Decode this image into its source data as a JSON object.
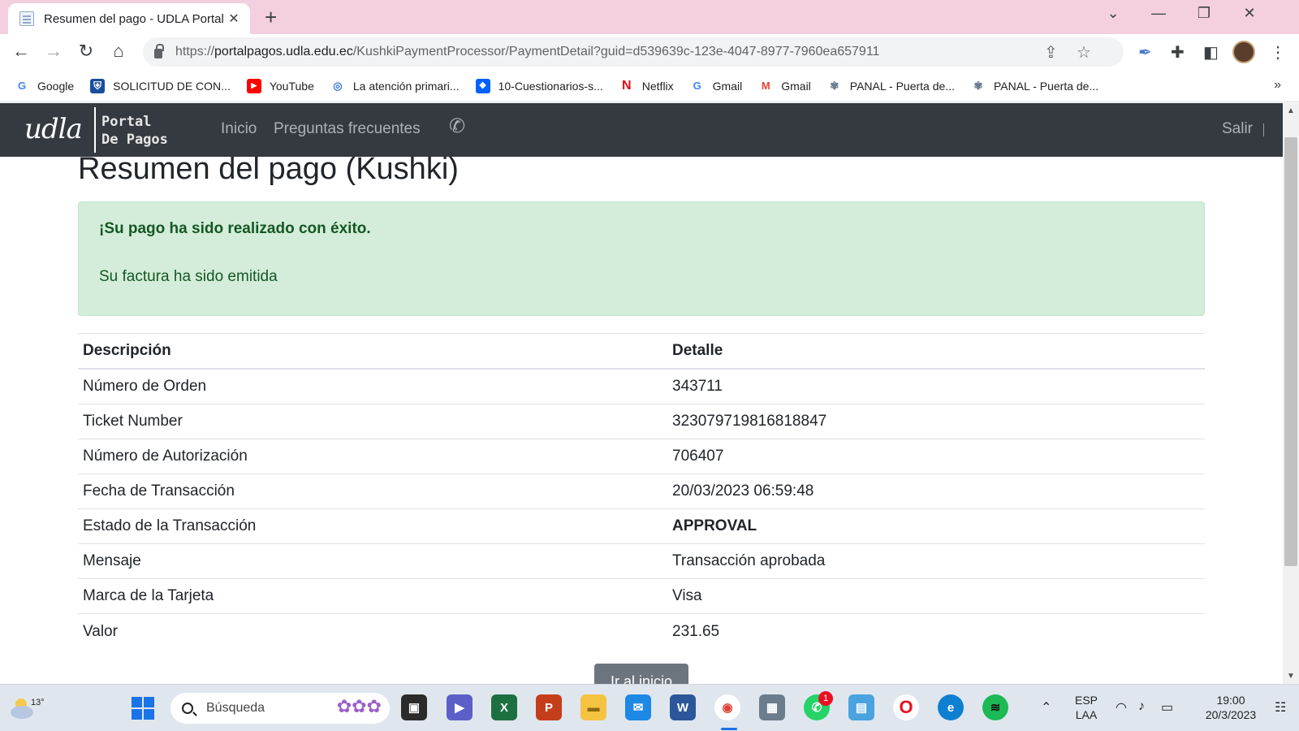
{
  "browser": {
    "tab_title": "Resumen del pago - UDLA Portal",
    "url_scheme": "https://",
    "url_host": "portalpagos.udla.edu.ec",
    "url_path": "/KushkiPaymentProcessor/PaymentDetail?guid=d539639c-123e-4047-8977-7960ea657911",
    "bookmarks": [
      {
        "label": "Google",
        "icon": "google-icon",
        "color": "#4285f4"
      },
      {
        "label": "SOLICITUD DE CON...",
        "icon": "shield-icon",
        "color": "#1b4f9c"
      },
      {
        "label": "YouTube",
        "icon": "youtube-icon",
        "color": "#ff0000"
      },
      {
        "label": "La atención primari...",
        "icon": "un-icon",
        "color": "#3a7bd5"
      },
      {
        "label": "10-Cuestionarios-s...",
        "icon": "dropbox-icon",
        "color": "#0061ff"
      },
      {
        "label": "Netflix",
        "icon": "netflix-icon",
        "color": "#e50914"
      },
      {
        "label": "Gmail",
        "icon": "google-icon",
        "color": "#4285f4"
      },
      {
        "label": "Gmail",
        "icon": "gmail-icon",
        "color": "#ea4335"
      },
      {
        "label": "PANAL - Puerta de...",
        "icon": "bees-icon",
        "color": "#6b7a8f"
      },
      {
        "label": "PANAL - Puerta de...",
        "icon": "bees-icon",
        "color": "#6b7a8f"
      }
    ]
  },
  "navbar": {
    "logo_script": "udla",
    "logo_text": "Portal De Pagos",
    "links": [
      "Inicio",
      "Preguntas frecuentes"
    ],
    "logout": "Salir"
  },
  "page": {
    "title": "Resumen del pago (Kushki)",
    "alert_title": "¡Su pago ha sido realizado con éxito.",
    "alert_message": "Su factura ha sido emitida",
    "table": {
      "headers": [
        "Descripción",
        "Detalle"
      ],
      "rows": [
        {
          "label": "Número de Orden",
          "value": "343711"
        },
        {
          "label": "Ticket Number",
          "value": "323079719816818847"
        },
        {
          "label": "Número de Autorización",
          "value": "706407"
        },
        {
          "label": "Fecha de Transacción",
          "value": "20/03/2023 06:59:48"
        },
        {
          "label": "Estado de la Transacción",
          "value": "APPROVAL"
        },
        {
          "label": "Mensaje",
          "value": "Transacción aprobada"
        },
        {
          "label": "Marca de la Tarjeta",
          "value": "Visa"
        },
        {
          "label": "Valor",
          "value": "231.65"
        }
      ]
    },
    "home_button": "Ir al inicio"
  },
  "taskbar": {
    "weather_temp": "13°",
    "search_placeholder": "Búsqueda",
    "whatsapp_badge": "1",
    "language_line1": "ESP",
    "language_line2": "LAA",
    "time": "19:00",
    "date": "20/3/2023"
  }
}
